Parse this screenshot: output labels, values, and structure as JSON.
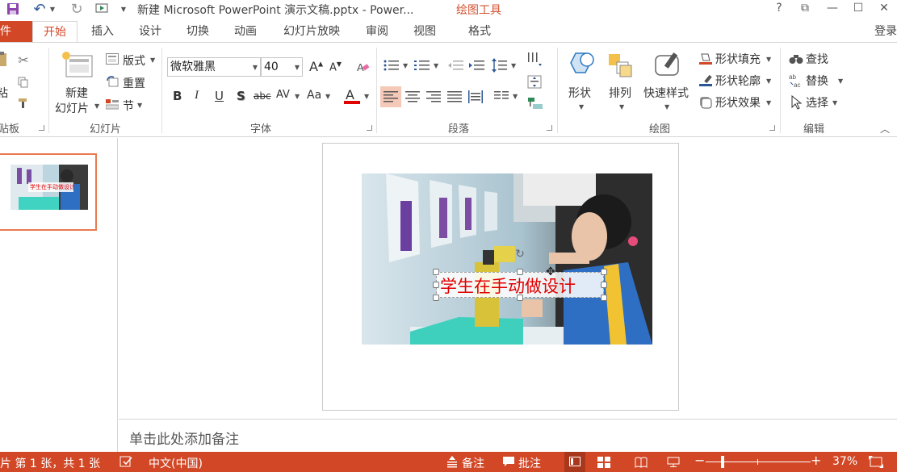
{
  "titlebar": {
    "title": "新建 Microsoft PowerPoint 演示文稿.pptx - Power...",
    "context_tools": "绘图工具",
    "help": "?",
    "restore_ribbon": "⧉",
    "minimize": "—",
    "maximize": "☐",
    "close": "✕"
  },
  "tabs": {
    "file": "件",
    "home": "开始",
    "insert": "插入",
    "design": "设计",
    "transitions": "切换",
    "animations": "动画",
    "slideshow": "幻灯片放映",
    "review": "审阅",
    "view": "视图",
    "format": "格式",
    "login": "登录"
  },
  "ribbon": {
    "clipboard": {
      "paste": "粘",
      "label": "贴板"
    },
    "slides": {
      "new_slide": "新建",
      "new_slide2": "幻灯片",
      "layout": "版式",
      "reset": "重置",
      "section": "节",
      "label": "幻灯片"
    },
    "font": {
      "font_name": "微软雅黑",
      "font_size": "40",
      "grow": "A",
      "shrink": "A",
      "bold": "B",
      "italic": "I",
      "underline": "U",
      "shadow": "S",
      "strike": "abc",
      "spacing": "AV",
      "case": "Aa",
      "color_letter": "A",
      "label": "字体"
    },
    "paragraph": {
      "label": "段落"
    },
    "drawing": {
      "shapes": "形状",
      "arrange": "排列",
      "quick_styles": "快速样式",
      "fill": "形状填充",
      "outline": "形状轮廓",
      "effects": "形状效果",
      "label": "绘图"
    },
    "editing": {
      "find": "查找",
      "replace": "替换",
      "select": "选择",
      "label": "编辑"
    }
  },
  "slide": {
    "caption": "学生在手动做设计",
    "thumb_caption": "学生在手动做设计"
  },
  "notes": {
    "placeholder": "单击此处添加备注"
  },
  "status": {
    "slide_info": "片 第 1 张，共 1 张",
    "language": "中文(中国)",
    "notes": "备注",
    "comments": "批注",
    "zoom": "37%",
    "zoom_minus": "−",
    "zoom_plus": "+"
  },
  "colors": {
    "accent": "#d24726",
    "caption_red": "#e00000",
    "thumb_border": "#e97a4f"
  }
}
